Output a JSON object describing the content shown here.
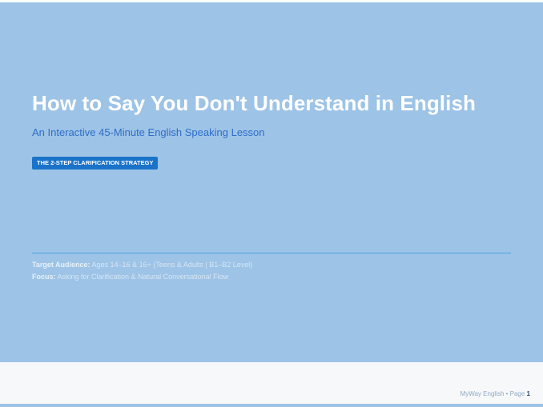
{
  "hero": {
    "title": "How to Say You Don't Understand in English",
    "subtitle": "An Interactive 45-Minute English Speaking Lesson",
    "badge": "THE 2-STEP CLARIFICATION STRATEGY",
    "target_audience_label": "Target Audience:",
    "target_audience_value": " Ages 14–16 & 16+ (Teens & Adults | B1–B2 Level)",
    "focus_label": "Focus:",
    "focus_value": " Asking for Clarification & Natural Conversational Flow"
  },
  "footer": {
    "brand": "MyWay English • Page ",
    "page_number": "1"
  },
  "colors": {
    "hero_background": "#9dc3e6",
    "title": "#ffffff",
    "subtitle": "#2f6dc9",
    "badge_background": "#1a73c9",
    "divider": "#4aa3e8"
  }
}
